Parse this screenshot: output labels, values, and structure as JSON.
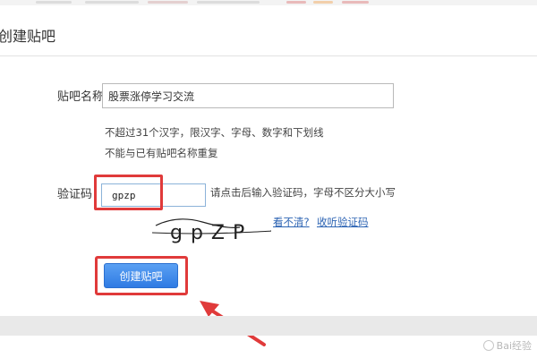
{
  "dialog": {
    "title": "创建贴吧"
  },
  "form": {
    "name_label": "贴吧名称：",
    "name_value": "股票涨停学习交流",
    "hints": [
      "不超过31个汉字，限汉字、字母、数字和下划线",
      "不能与已有贴吧名称重复"
    ],
    "captcha_label": "验证码：",
    "captcha_value": "gpzp",
    "captcha_hint": "请点击后输入验证码，字母不区分大小写",
    "captcha_image_text": "gpZP",
    "refresh_link": "看不清?",
    "audio_link": "收听验证码",
    "submit_label": "创建贴吧"
  },
  "watermark": {
    "text": "Bai经验"
  },
  "colors": {
    "highlight_red": "#e03a3a",
    "button_blue": "#3b86ea",
    "link_blue": "#2d64b3"
  }
}
